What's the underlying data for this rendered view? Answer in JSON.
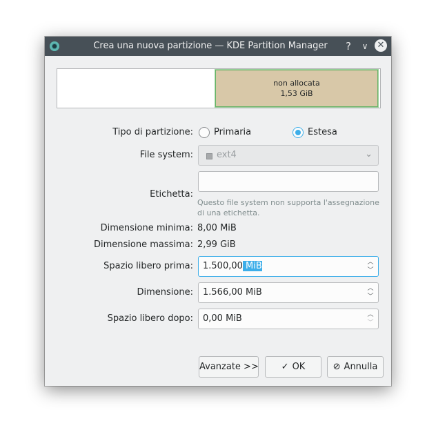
{
  "window": {
    "title": "Crea una nuova partizione — KDE Partition Manager",
    "help_glyph": "?",
    "minimize_glyph": "∨",
    "close_glyph": "✕"
  },
  "partition_graphic": {
    "label": "non allocata",
    "size": "1,53 GiB"
  },
  "form": {
    "type_label": "Tipo di partizione:",
    "type_options": [
      {
        "label": "Primaria",
        "checked": false
      },
      {
        "label": "Estesa",
        "checked": true
      }
    ],
    "fs_label": "File system:",
    "fs_value": "ext4",
    "fs_icon": "square-icon",
    "label_label": "Etichetta:",
    "label_value": "",
    "label_hint": "Questo file system non supporta l'assegnazione di una etichetta.",
    "min_label": "Dimensione minima:",
    "min_value": "8,00 MiB",
    "max_label": "Dimensione massima:",
    "max_value": "2,99 GiB",
    "free_before_label": "Spazio libero prima:",
    "free_before_number": "1.500,00",
    "free_before_unit": "MiB",
    "size_label": "Dimensione:",
    "size_value": "1.566,00 MiB",
    "free_after_label": "Spazio libero dopo:",
    "free_after_value": "0,00 MiB"
  },
  "buttons": {
    "advanced": "Avanzate >>",
    "ok": "OK",
    "cancel": "Annulla"
  },
  "colors": {
    "titlebar": "#475057",
    "accent": "#3daee9",
    "unallocated": "#d8c8a8",
    "window_bg": "#eff0f1"
  }
}
